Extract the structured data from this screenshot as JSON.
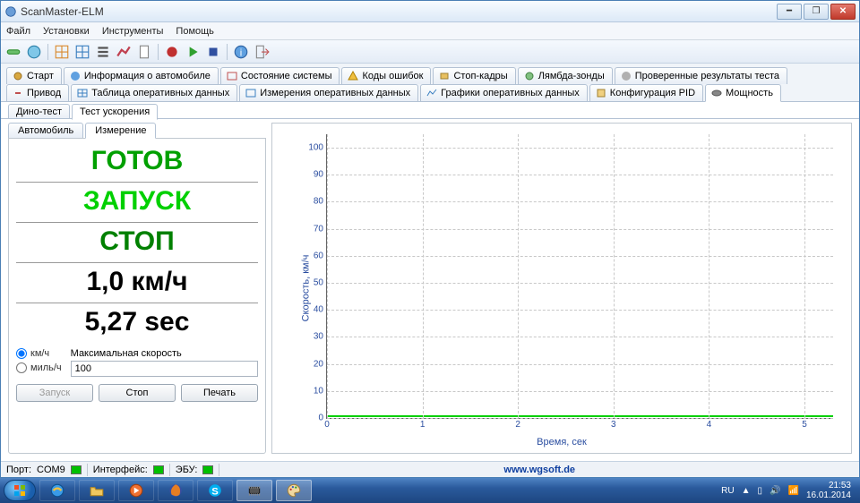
{
  "window": {
    "title": "ScanMaster-ELM"
  },
  "menu": {
    "file": "Файл",
    "settings": "Установки",
    "tools": "Инструменты",
    "help": "Помощь"
  },
  "tabs_row1": {
    "start": "Старт",
    "vehicle_info": "Информация о автомобиле",
    "system_status": "Состояние системы",
    "error_codes": "Коды ошибок",
    "freeze_frames": "Стоп-кадры",
    "lambda": "Лямбда-зонды",
    "test_results": "Проверенные результаты теста"
  },
  "tabs_row2": {
    "drive": "Привод",
    "data_table": "Таблица оперативных данных",
    "data_measure": "Измерения оперативных данных",
    "data_charts": "Графики оперативных данных",
    "pid_config": "Конфигурация PID",
    "power": "Мощность"
  },
  "subtabs": {
    "dyno": "Дино-тест",
    "accel": "Тест ускорения"
  },
  "panel_tabs": {
    "vehicle": "Автомобиль",
    "measure": "Измерение"
  },
  "status": {
    "ready": "ГОТОВ",
    "start": "ЗАПУСК",
    "stop": "СТОП",
    "speed": "1,0 км/ч",
    "time": "5,27 sec"
  },
  "units": {
    "kmh": "км/ч",
    "mph": "миль/ч"
  },
  "maxspeed": {
    "label": "Максимальная скорость",
    "value": "100"
  },
  "buttons": {
    "launch": "Запуск",
    "stop": "Стоп",
    "print": "Печать"
  },
  "chart": {
    "ylabel": "Скорость, км/ч",
    "xlabel": "Время, сек"
  },
  "statusbar": {
    "port_label": "Порт:",
    "port_value": "COM9",
    "iface_label": "Интерфейс:",
    "ecu_label": "ЭБУ:",
    "url": "www.wgsoft.de"
  },
  "tray": {
    "lang": "RU",
    "time": "21:53",
    "date": "16.01.2014"
  },
  "chart_data": {
    "type": "line",
    "xlabel": "Время, сек",
    "ylabel": "Скорость, км/ч",
    "xlim": [
      0,
      5.3
    ],
    "ylim": [
      0,
      105
    ],
    "xticks": [
      0,
      1,
      2,
      3,
      4,
      5
    ],
    "yticks": [
      0,
      10,
      20,
      30,
      40,
      50,
      60,
      70,
      80,
      90,
      100
    ],
    "series": [
      {
        "name": "speed",
        "x": [
          0,
          0.3,
          0.6,
          5.27
        ],
        "values": [
          1.0,
          1.5,
          1.0,
          1.0
        ]
      }
    ]
  }
}
